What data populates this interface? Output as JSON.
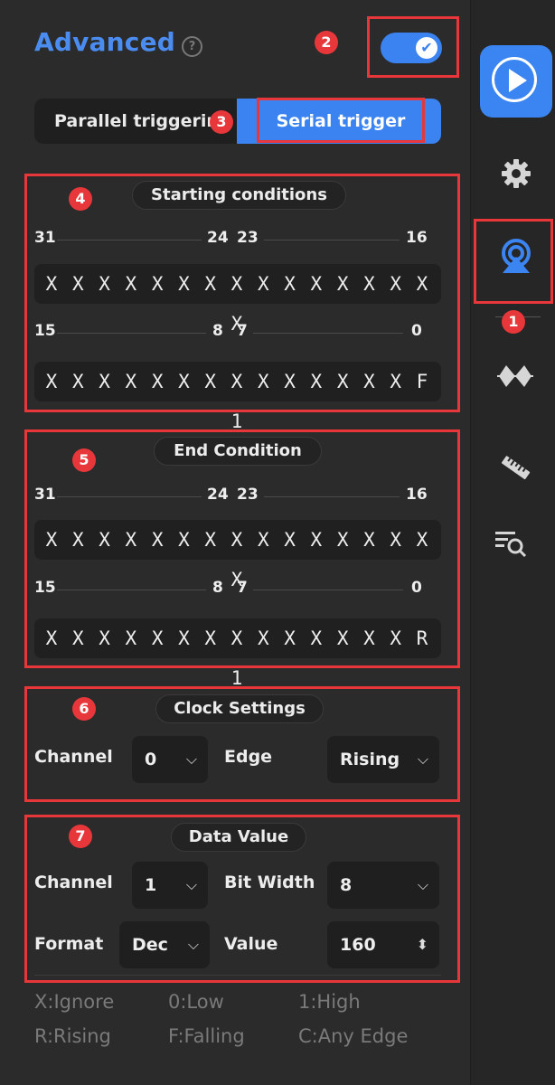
{
  "header": {
    "title": "Advanced",
    "help_glyph": "?",
    "toggle_on": true,
    "toggle_glyph": "✔"
  },
  "tabs": {
    "parallel_label": "Parallel triggering",
    "serial_label": "Serial trigger",
    "active": "serial"
  },
  "start_section": {
    "title": "Starting conditions",
    "high_ruler": {
      "left": "31",
      "mid_a": "24",
      "mid_b": "23",
      "right": "16"
    },
    "high_bits": "X X X X X X X X X X X X X X X X",
    "low_ruler": {
      "left": "15",
      "mid_a": "8",
      "mid_b": "7",
      "right": "0"
    },
    "low_bits": "X X X X X X X X X X X X X X F 1"
  },
  "end_section": {
    "title": "End Condition",
    "high_ruler": {
      "left": "31",
      "mid_a": "24",
      "mid_b": "23",
      "right": "16"
    },
    "high_bits": "X X X X X X X X X X X X X X X X",
    "low_ruler": {
      "left": "15",
      "mid_a": "8",
      "mid_b": "7",
      "right": "0"
    },
    "low_bits": "X X X X X X X X X X X X X X R 1"
  },
  "clock_section": {
    "title": "Clock Settings",
    "channel_label": "Channel",
    "channel_value": "0",
    "edge_label": "Edge",
    "edge_value": "Rising"
  },
  "data_section": {
    "title": "Data Value",
    "channel_label": "Channel",
    "channel_value": "1",
    "bitwidth_label": "Bit Width",
    "bitwidth_value": "8",
    "format_label": "Format",
    "format_value": "Dec",
    "value_label": "Value",
    "value_value": "160"
  },
  "legend": {
    "ignore": "X:Ignore",
    "low": "0:Low",
    "high": "1:High",
    "rising": "R:Rising",
    "falling": "F:Falling",
    "any": "C:Any Edge"
  },
  "badges": [
    "1",
    "2",
    "3",
    "4",
    "5",
    "6",
    "7"
  ],
  "glyphs": {
    "chevron": "⌵",
    "stepper": "⬍"
  },
  "rail_icons": [
    "play-icon",
    "gear-icon",
    "trigger-icon",
    "measure-wave-icon",
    "ruler-icon",
    "search-list-icon"
  ],
  "colors": {
    "accent": "#3a83f0",
    "annotation": "#e8373a",
    "background": "#2b2b2b"
  }
}
